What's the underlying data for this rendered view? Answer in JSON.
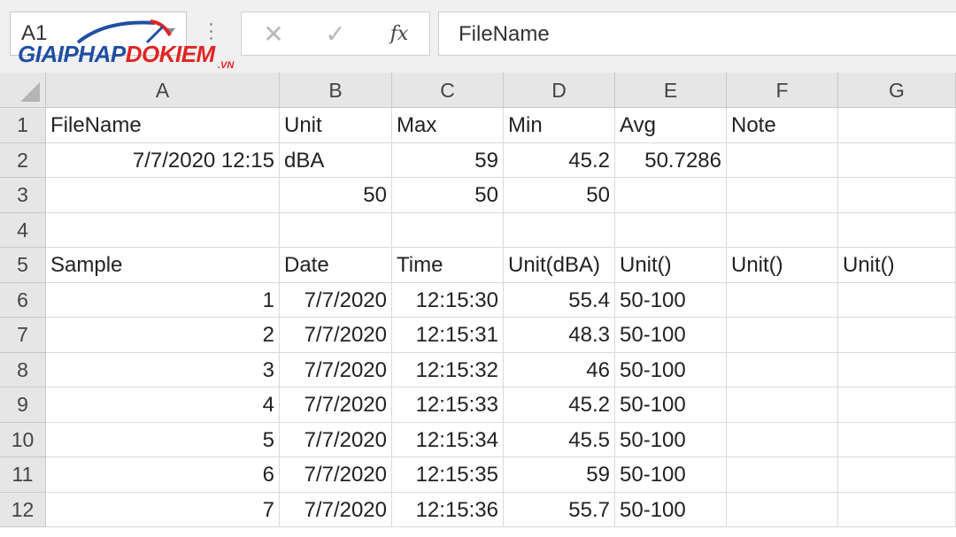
{
  "name_box": {
    "value": "A1"
  },
  "logo": {
    "blue": "GIAIPHAP",
    "red": "DOKIEM",
    "suffix": ".VN"
  },
  "formula_bar": {
    "cancel": "✕",
    "enter": "✓",
    "fx": "fx",
    "value": "FileName"
  },
  "columns": [
    "A",
    "B",
    "C",
    "D",
    "E",
    "F",
    "G"
  ],
  "rows": [
    {
      "n": "1",
      "cells": [
        "FileName",
        "Unit",
        "Max",
        "Min",
        "Avg",
        "Note",
        ""
      ]
    },
    {
      "n": "2",
      "cells": [
        "7/7/2020 12:15",
        "dBA",
        "59",
        "45.2",
        "50.7286",
        "",
        ""
      ]
    },
    {
      "n": "3",
      "cells": [
        "",
        "50",
        "50",
        "50",
        "",
        "",
        ""
      ]
    },
    {
      "n": "4",
      "cells": [
        "",
        "",
        "",
        "",
        "",
        "",
        ""
      ]
    },
    {
      "n": "5",
      "cells": [
        "Sample",
        "Date",
        "Time",
        "Unit(dBA)",
        "Unit()",
        "Unit()",
        "Unit()"
      ]
    },
    {
      "n": "6",
      "cells": [
        "1",
        "7/7/2020",
        "12:15:30",
        "55.4",
        "50-100",
        "",
        ""
      ]
    },
    {
      "n": "7",
      "cells": [
        "2",
        "7/7/2020",
        "12:15:31",
        "48.3",
        "50-100",
        "",
        ""
      ]
    },
    {
      "n": "8",
      "cells": [
        "3",
        "7/7/2020",
        "12:15:32",
        "46",
        "50-100",
        "",
        ""
      ]
    },
    {
      "n": "9",
      "cells": [
        "4",
        "7/7/2020",
        "12:15:33",
        "45.2",
        "50-100",
        "",
        ""
      ]
    },
    {
      "n": "10",
      "cells": [
        "5",
        "7/7/2020",
        "12:15:34",
        "45.5",
        "50-100",
        "",
        ""
      ]
    },
    {
      "n": "11",
      "cells": [
        "6",
        "7/7/2020",
        "12:15:35",
        "59",
        "50-100",
        "",
        ""
      ]
    },
    {
      "n": "12",
      "cells": [
        "7",
        "7/7/2020",
        "12:15:36",
        "55.7",
        "50-100",
        "",
        ""
      ]
    }
  ]
}
